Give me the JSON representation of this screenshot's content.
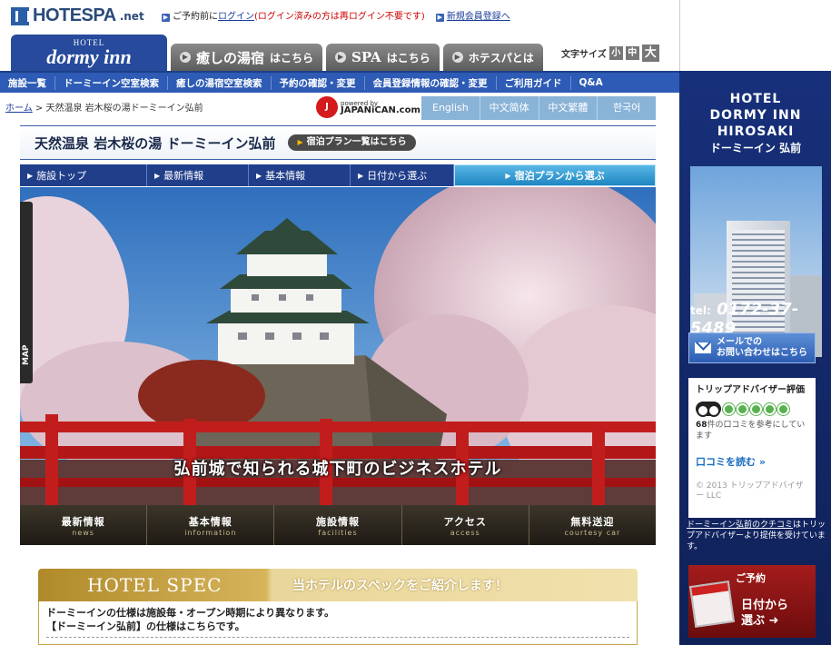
{
  "site": {
    "logo_text": "HOTESPA",
    "logo_suffix": ".net"
  },
  "toplinks": {
    "prefix": "ご予約前に",
    "login": "ログイン",
    "note": "(ログイン済みの方は再ログイン不要です)",
    "register": "新規会員登録へ"
  },
  "brand_tabs": {
    "dormy_hotel": "HOTEL",
    "dormy_name": "dormy inn",
    "iyashi": "癒しの湯宿",
    "iyashi_suffix": "はこちら",
    "spa": "SPA",
    "spa_suffix": "はこちら",
    "hotespa": "ホテスパとは"
  },
  "fontsize": {
    "label": "文字サイズ",
    "small": "小",
    "medium": "中",
    "large": "大"
  },
  "global_nav": [
    "施設一覧",
    "ドーミーイン空室検索",
    "癒しの湯宿空室検索",
    "予約の確認・変更",
    "会員登録情報の確認・変更",
    "ご利用ガイド",
    "Q&A"
  ],
  "breadcrumb": {
    "home": "ホーム",
    "sep": ">",
    "current": "天然温泉 岩木桜の湯ドーミーイン弘前"
  },
  "powered": {
    "by": "powered by",
    "brand": "JAPANiCAN.com"
  },
  "languages": [
    "English",
    "中文简体",
    "中文繁體",
    "한국어"
  ],
  "hotel": {
    "title": "天然温泉 岩木桜の湯 ドーミーイン弘前",
    "plan_button": "宿泊プラン一覧はこちら"
  },
  "subnav": [
    "施設トップ",
    "最新情報",
    "基本情報",
    "日付から選ぶ",
    "宿泊プランから選ぶ"
  ],
  "hero": {
    "caption": "弘前城で知られる城下町のビジネスホテル",
    "map_tab": "MAP"
  },
  "dark_menu": [
    {
      "jp": "最新情報",
      "en": "news"
    },
    {
      "jp": "基本情報",
      "en": "information"
    },
    {
      "jp": "施設情報",
      "en": "facilities"
    },
    {
      "jp": "アクセス",
      "en": "access"
    },
    {
      "jp": "無料送迎",
      "en": "courtesy car"
    }
  ],
  "spec": {
    "title": "HOTEL SPEC",
    "subtitle": "当ホテルのスペックをご紹介します！",
    "line1": "ドーミーインの仕様は施設毎・オープン時期により異なります。",
    "line2": "【ドーミーイン弘前】の仕様はこちらです。"
  },
  "sidebar": {
    "hotel_name_1": "HOTEL",
    "hotel_name_2": "DORMY INN",
    "hotel_name_3": "HIROSAKI",
    "hotel_name_jp": "ドーミーイン 弘前",
    "tel_label": "tel:",
    "tel_number": "0172-37-5489",
    "mail_line1": "メールでの",
    "mail_line2": "お問い合わせはこちら",
    "trip_title": "トリップアドバイザー評価",
    "trip_count": "68",
    "trip_text": "件の口コミを参考にしています",
    "trip_read": "口コミを読む »",
    "trip_copy": "© 2013 トリップアドバイザー LLC",
    "trip_note_link": "ドーミーイン弘前のクチコミ",
    "trip_note_rest": "はトリップアドバイザーより提供を受けています。",
    "reserve_top": "ご予約",
    "reserve_line1": "日付から",
    "reserve_line2": "選ぶ ➜"
  },
  "colors": {
    "nav_blue": "#2d5bb5",
    "sidebar_navy": "#17307a",
    "spec_gold": "#c9a445",
    "accent_red": "#d41a1a"
  }
}
